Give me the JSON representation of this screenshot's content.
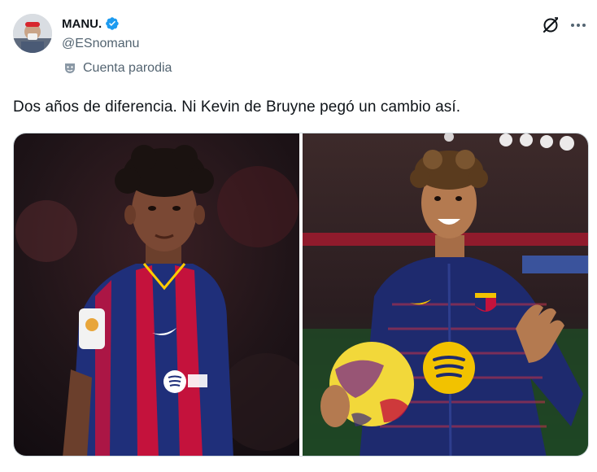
{
  "tweet": {
    "author": {
      "display_name": "MANU.",
      "handle": "@ESnomanu",
      "verified": true,
      "parody_label": "Cuenta parodia",
      "avatar_icon": "avatar-photo"
    },
    "text": "Dos años de diferencia. Ni Kevin de Bruyne pegó un cambio así.",
    "actions": {
      "grok_icon": "grok-icon",
      "more_icon": "more-options-icon"
    },
    "media": [
      {
        "icon": "photo-player-barcelona-home-kit",
        "kit_color_primary": "#1f2f7a",
        "kit_color_secondary": "#c4123c"
      },
      {
        "icon": "photo-player-holding-ball",
        "kit_color_primary": "#1e2a6e",
        "badge_color": "#f2c200"
      }
    ],
    "colors": {
      "text": "#0f1419",
      "secondary": "#536471",
      "verified": "#1d9bf0",
      "border": "#cfd9de"
    }
  }
}
